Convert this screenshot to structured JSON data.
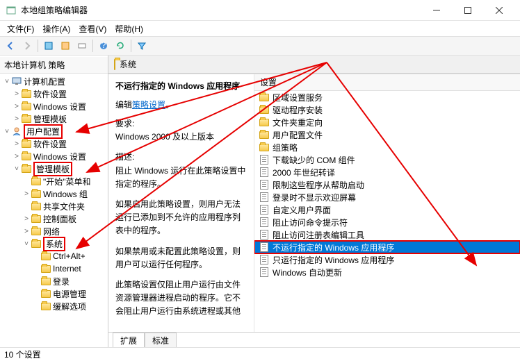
{
  "window": {
    "title": "本地组策略编辑器"
  },
  "menubar": [
    "文件(F)",
    "操作(A)",
    "查看(V)",
    "帮助(H)"
  ],
  "tree": {
    "header": "本地计算机 策略",
    "items": [
      {
        "label": "计算机配置",
        "indent": 0,
        "exp": "˅",
        "icon": "comp"
      },
      {
        "label": "软件设置",
        "indent": 1,
        "exp": ">",
        "icon": "folder"
      },
      {
        "label": "Windows 设置",
        "indent": 1,
        "exp": ">",
        "icon": "folder"
      },
      {
        "label": "管理模板",
        "indent": 1,
        "exp": ">",
        "icon": "folder"
      },
      {
        "label": "用户配置",
        "indent": 0,
        "exp": "˅",
        "icon": "user",
        "hl": true
      },
      {
        "label": "软件设置",
        "indent": 1,
        "exp": ">",
        "icon": "folder"
      },
      {
        "label": "Windows 设置",
        "indent": 1,
        "exp": ">",
        "icon": "folder"
      },
      {
        "label": "管理模板",
        "indent": 1,
        "exp": "˅",
        "icon": "folder",
        "hl": true
      },
      {
        "label": "\"开始\"菜单和",
        "indent": 2,
        "exp": "",
        "icon": "folder"
      },
      {
        "label": "Windows 组",
        "indent": 2,
        "exp": ">",
        "icon": "folder"
      },
      {
        "label": "共享文件夹",
        "indent": 2,
        "exp": "",
        "icon": "folder"
      },
      {
        "label": "控制面板",
        "indent": 2,
        "exp": ">",
        "icon": "folder"
      },
      {
        "label": "网络",
        "indent": 2,
        "exp": ">",
        "icon": "folder"
      },
      {
        "label": "系统",
        "indent": 2,
        "exp": "˅",
        "icon": "folder",
        "hl": true
      },
      {
        "label": "Ctrl+Alt+",
        "indent": 3,
        "exp": "",
        "icon": "folder"
      },
      {
        "label": "Internet",
        "indent": 3,
        "exp": "",
        "icon": "folder"
      },
      {
        "label": "登录",
        "indent": 3,
        "exp": "",
        "icon": "folder"
      },
      {
        "label": "电源管理",
        "indent": 3,
        "exp": "",
        "icon": "folder"
      },
      {
        "label": "缓解选项",
        "indent": 3,
        "exp": "",
        "icon": "folder"
      }
    ]
  },
  "content": {
    "header": "系统",
    "policy_title": "不运行指定的 Windows 应用程序",
    "edit_label": "编辑",
    "link_label": "策略设置",
    "req_label": "要求:",
    "req_text": "Windows 2000 及以上版本",
    "desc_label": "描述:",
    "desc1": "阻止 Windows 运行在此策略设置中指定的程序。",
    "desc2": "如果启用此策略设置，则用户无法运行已添加到不允许的应用程序列表中的程序。",
    "desc3": "如果禁用或未配置此策略设置，则用户可以运行任何程序。",
    "desc4": "此策略设置仅阻止用户运行由文件资源管理器进程启动的程序。它不会阻止用户运行由系统进程或其他",
    "list_header": "设置",
    "items": [
      {
        "icon": "folder",
        "label": "区域设置服务"
      },
      {
        "icon": "folder",
        "label": "驱动程序安装"
      },
      {
        "icon": "folder",
        "label": "文件夹重定向"
      },
      {
        "icon": "folder",
        "label": "用户配置文件"
      },
      {
        "icon": "folder",
        "label": "组策略"
      },
      {
        "icon": "sheet",
        "label": "下载缺少的 COM 组件"
      },
      {
        "icon": "sheet",
        "label": "2000 年世纪转译"
      },
      {
        "icon": "sheet",
        "label": "限制这些程序从帮助启动"
      },
      {
        "icon": "sheet",
        "label": "登录时不显示欢迎屏幕"
      },
      {
        "icon": "sheet",
        "label": "自定义用户界面"
      },
      {
        "icon": "sheet",
        "label": "阻止访问命令提示符"
      },
      {
        "icon": "sheet",
        "label": "阻止访问注册表编辑工具"
      },
      {
        "icon": "sheet",
        "label": "不运行指定的 Windows 应用程序",
        "selected": true,
        "hl": true
      },
      {
        "icon": "sheet",
        "label": "只运行指定的 Windows 应用程序"
      },
      {
        "icon": "sheet",
        "label": "Windows 自动更新"
      }
    ]
  },
  "tabs": [
    "扩展",
    "标准"
  ],
  "status": "10 个设置"
}
